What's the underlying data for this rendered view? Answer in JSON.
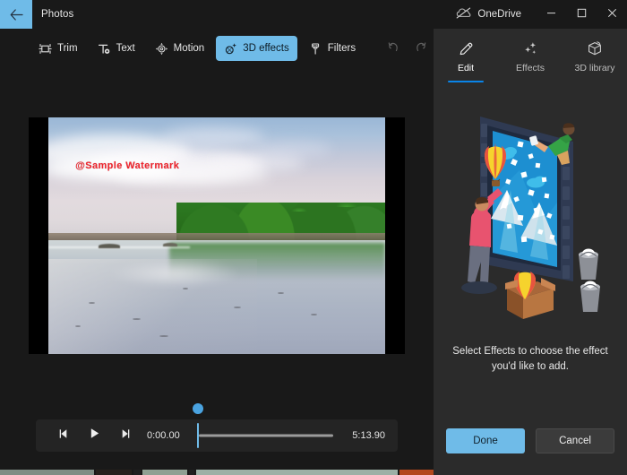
{
  "titlebar": {
    "back_icon": "back-arrow-icon",
    "app_title": "Photos",
    "onedrive_label": "OneDrive",
    "onedrive_icon": "onedrive-offline-cloud-icon",
    "minimize_label": "Minimize",
    "maximize_label": "Maximize",
    "close_label": "Close"
  },
  "toolbar": {
    "items": [
      {
        "label": "Trim",
        "icon": "trim-icon",
        "active": false
      },
      {
        "label": "Text",
        "icon": "text-icon",
        "active": false
      },
      {
        "label": "Motion",
        "icon": "motion-icon",
        "active": false
      },
      {
        "label": "3D effects",
        "icon": "3d-effects-icon",
        "active": true
      },
      {
        "label": "Filters",
        "icon": "filters-icon",
        "active": false
      }
    ],
    "undo_icon": "undo-icon",
    "redo_icon": "redo-icon"
  },
  "preview": {
    "watermark_text": "@Sample  Watermark",
    "watermark_color": "#f0222b",
    "scene_description": "tropical beach with wet reflective sand and jungle"
  },
  "player": {
    "prev_frame_icon": "previous-frame-icon",
    "play_icon": "play-icon",
    "next_frame_icon": "next-frame-icon",
    "current_time": "0:00.00",
    "duration": "5:13.90",
    "progress_percent": 0
  },
  "panel": {
    "tabs": [
      {
        "label": "Edit",
        "icon": "pencil-icon",
        "active": true
      },
      {
        "label": "Effects",
        "icon": "sparkles-icon",
        "active": false
      },
      {
        "label": "3D library",
        "icon": "cube-icon",
        "active": false
      }
    ],
    "illustration_name": "effects-empty-state-illustration",
    "message": "Select Effects to choose the effect you'd like to add.",
    "done_label": "Done",
    "cancel_label": "Cancel"
  },
  "colors": {
    "accent_blue": "#6fbbe8",
    "tab_underline": "#0a84e8",
    "window_bg": "#191919",
    "panel_bg": "#2b2b2b",
    "controls_bg": "#242424",
    "watermark_red": "#f0222b"
  },
  "storyboard": {
    "thumbs": [
      "#7e8d84",
      "#26211c",
      "#8fa093",
      "#9db0a6",
      "#b4481c",
      "#2a2a2a"
    ]
  }
}
